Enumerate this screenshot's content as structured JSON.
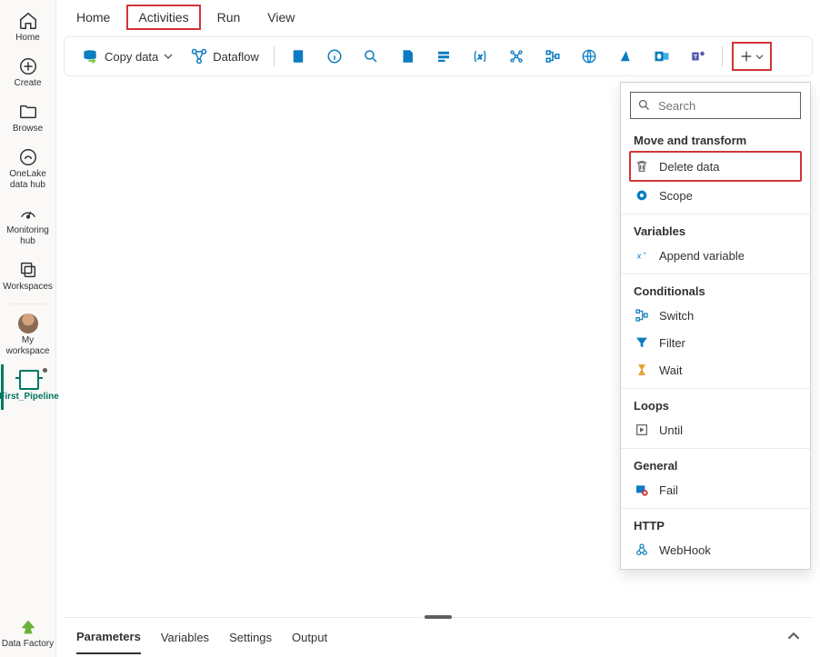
{
  "leftnav": [
    {
      "id": "home",
      "label": "Home"
    },
    {
      "id": "create",
      "label": "Create"
    },
    {
      "id": "browse",
      "label": "Browse"
    },
    {
      "id": "onelake",
      "label": "OneLake data hub"
    },
    {
      "id": "monitoring",
      "label": "Monitoring hub"
    },
    {
      "id": "workspaces",
      "label": "Workspaces"
    },
    {
      "id": "myws",
      "label": "My workspace"
    },
    {
      "id": "pipeline",
      "label": "First_Pipeline"
    }
  ],
  "footer_label": "Data Factory",
  "tabs": [
    "Home",
    "Activities",
    "Run",
    "View"
  ],
  "selected_tab": "Activities",
  "toolbar": {
    "copy_data": "Copy data",
    "dataflow": "Dataflow"
  },
  "dropdown": {
    "search_placeholder": "Search",
    "sections": [
      {
        "title": "Move and transform",
        "items": [
          {
            "id": "delete",
            "label": "Delete data",
            "highlight": true
          },
          {
            "id": "scope",
            "label": "Scope"
          }
        ]
      },
      {
        "title": "Variables",
        "items": [
          {
            "id": "appendvar",
            "label": "Append variable"
          }
        ]
      },
      {
        "title": "Conditionals",
        "items": [
          {
            "id": "switch",
            "label": "Switch"
          },
          {
            "id": "filter",
            "label": "Filter"
          },
          {
            "id": "wait",
            "label": "Wait"
          }
        ]
      },
      {
        "title": "Loops",
        "items": [
          {
            "id": "until",
            "label": "Until"
          }
        ]
      },
      {
        "title": "General",
        "items": [
          {
            "id": "fail",
            "label": "Fail"
          }
        ]
      },
      {
        "title": "HTTP",
        "items": [
          {
            "id": "webhook",
            "label": "WebHook"
          }
        ]
      }
    ]
  },
  "bottom_tabs": [
    "Parameters",
    "Variables",
    "Settings",
    "Output"
  ],
  "bottom_selected": "Parameters"
}
